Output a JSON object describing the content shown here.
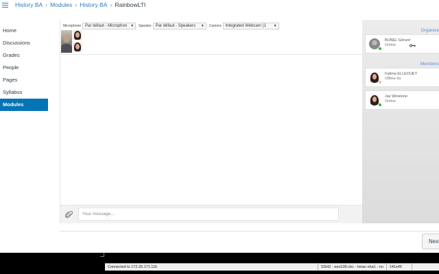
{
  "breadcrumb": {
    "items": [
      "History BA",
      "Modules",
      "History BA"
    ],
    "current": "RainbowLTI"
  },
  "course_nav": {
    "items": [
      "Home",
      "Discussions",
      "Grades",
      "People",
      "Pages",
      "Syllabus",
      "Modules"
    ],
    "active": "Modules"
  },
  "media": {
    "microphone_label": "Microphone",
    "microphone_value": "Par défaut - Microphon",
    "speaker_label": "Speaker",
    "speaker_value": "Par défaut - Speakers",
    "camera_label": "Camera",
    "camera_value": "Integrated Webcam (1"
  },
  "chat": {
    "placeholder": "Your message..."
  },
  "roster": {
    "organizer_title": "Organize",
    "members_title": "Members",
    "organizer": {
      "name": "BUNEL Gérard",
      "status": "Online",
      "presence": "online"
    },
    "members": [
      {
        "name": "Fatima ELLEOUET",
        "status": "Offline for",
        "presence": "offline"
      },
      {
        "name": "Jas Winstone",
        "status": "Online",
        "presence": "online"
      }
    ]
  },
  "footer": {
    "next_label": "Next"
  },
  "terminal_status": {
    "connection": "Connected to 172.25.171.116",
    "protocol": "SSH2 - aes128-cbc - hmac-sha1 - no",
    "size": "141x45"
  },
  "colors": {
    "link": "#2b7abc",
    "active_nav": "#0374b5",
    "online": "#34b233",
    "section_title": "#5b8fd6"
  },
  "icons": [
    "hamburger-icon",
    "chevron-right-icon",
    "paperclip-icon",
    "key-icon",
    "presence-dot-icon",
    "caret-down-icon"
  ]
}
